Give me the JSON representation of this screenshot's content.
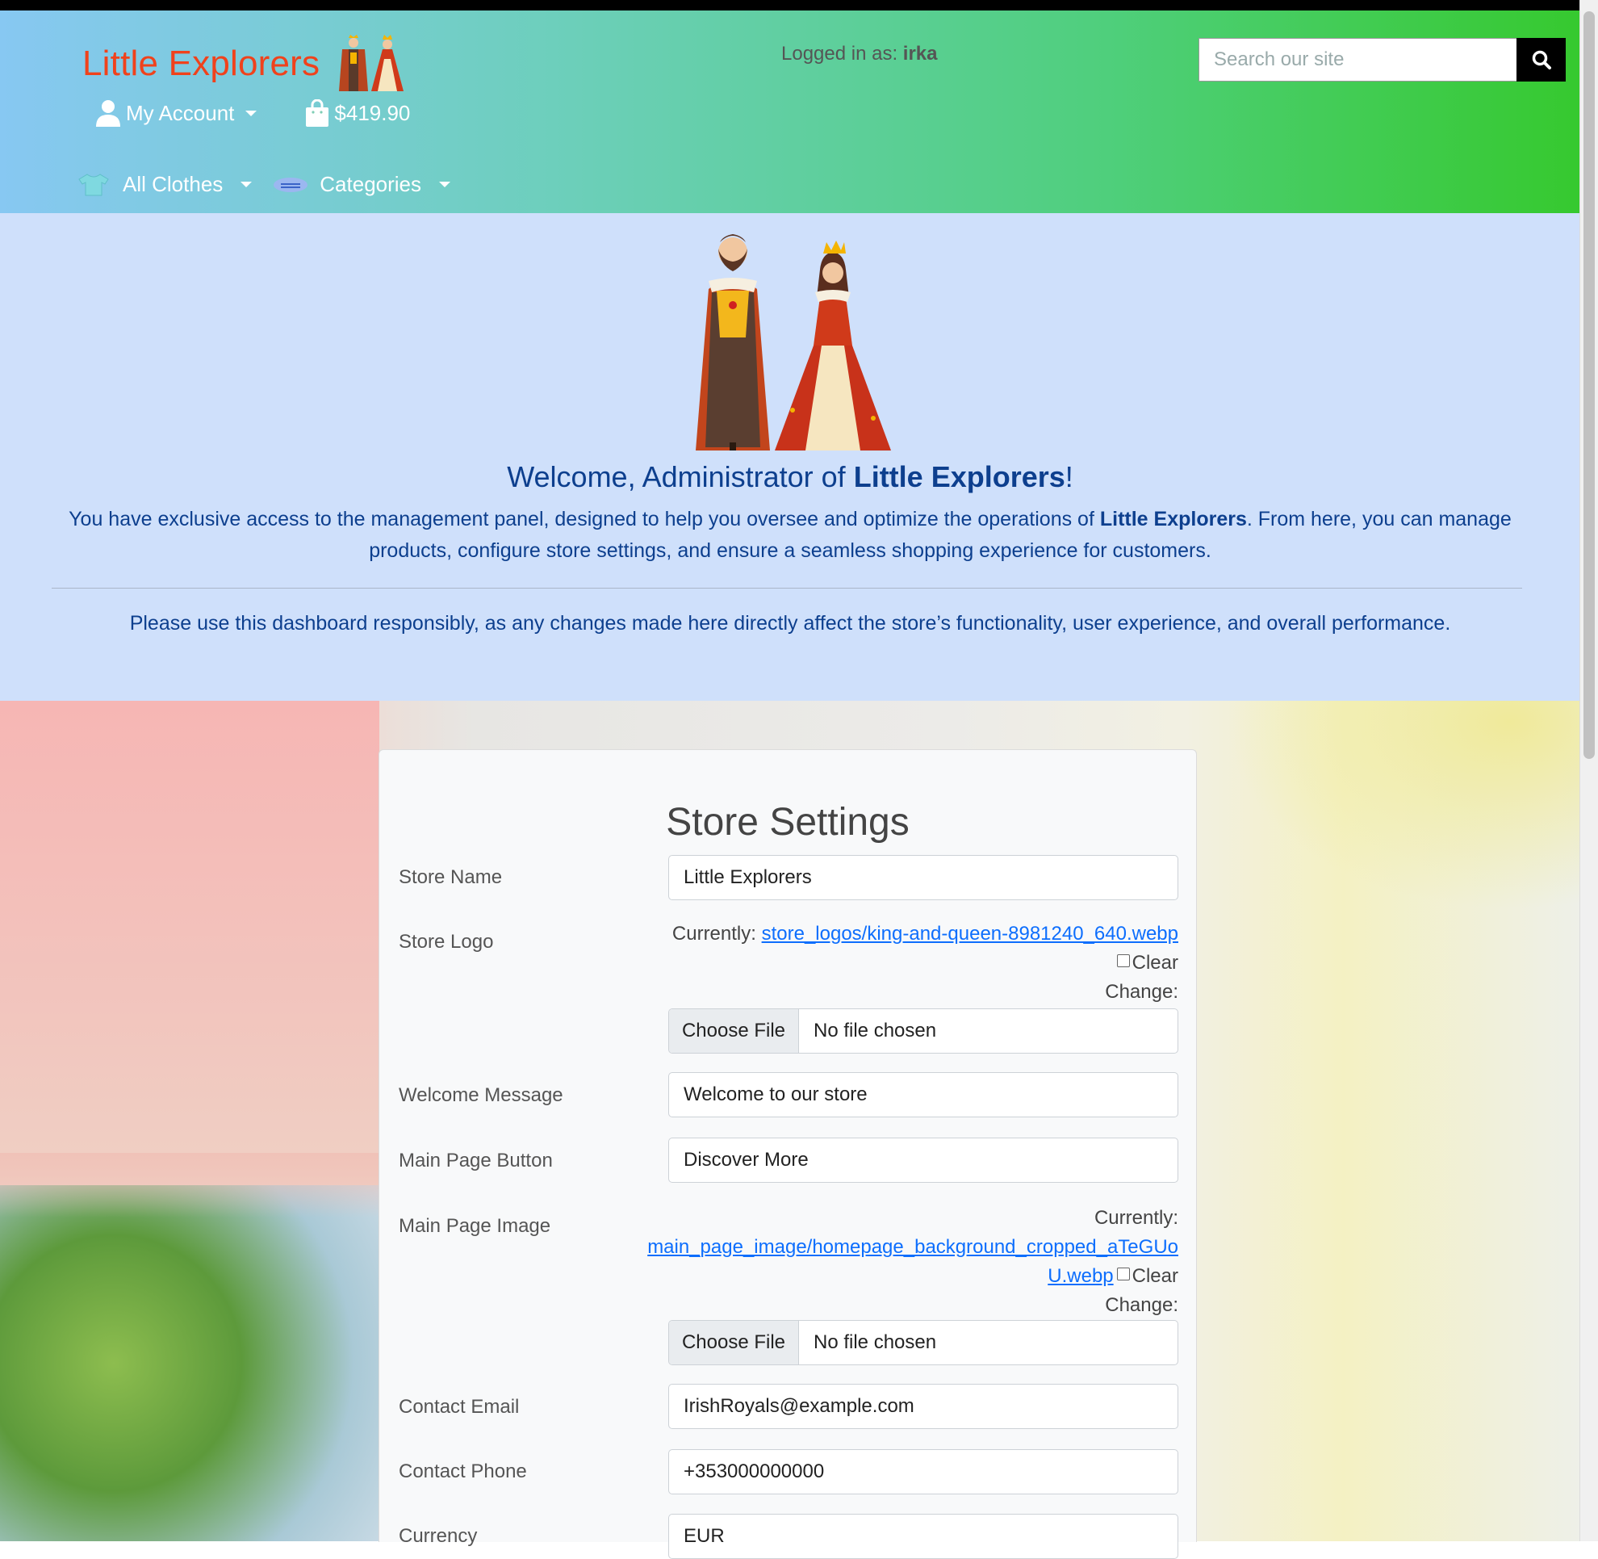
{
  "header": {
    "brand_name": "Little Explorers",
    "logged_in_prefix": "Logged in as:",
    "logged_in_user": "irka",
    "search_placeholder": "Search our site",
    "my_account_label": "My Account",
    "cart_total": "$419.90",
    "all_clothes_label": "All Clothes",
    "categories_label": "Categories",
    "colors": {
      "brand": "#f0421c",
      "gradient_start": "#87c8f2",
      "gradient_end": "#36c92f"
    }
  },
  "hero": {
    "welcome_prefix": "Welcome, Administrator of ",
    "store_name": "Little Explorers",
    "welcome_suffix": "!",
    "desc_part1": "You have exclusive access to the management panel, designed to help you oversee and optimize the operations of ",
    "desc_store": "Little Explorers",
    "desc_part2": ". From here, you can manage products, configure store settings, and ensure a seamless shopping experience for customers.",
    "warning": "Please use this dashboard responsibly, as any changes made here directly affect the store’s functionality, user experience, and overall performance."
  },
  "settings": {
    "title": "Store Settings",
    "store_name_label": "Store Name",
    "store_name_value": "Little Explorers",
    "store_logo_label": "Store Logo",
    "currently_label": "Currently:",
    "store_logo_link": "store_logos/king-and-queen-8981240_640.webp",
    "clear_label": "Clear",
    "change_label": "Change:",
    "choose_file_label": "Choose File",
    "no_file_label": "No file chosen",
    "welcome_message_label": "Welcome Message",
    "welcome_message_value": "Welcome to our store",
    "main_button_label": "Main Page Button",
    "main_button_value": "Discover More",
    "main_image_label": "Main Page Image",
    "main_image_link_line1": "main_page_image/homepage_background_cropped_aTeGUo",
    "main_image_link_line2": "U.webp",
    "contact_email_label": "Contact Email",
    "contact_email_value": "IrishRoyals@example.com",
    "contact_phone_label": "Contact Phone",
    "contact_phone_value": "+353000000000",
    "currency_label": "Currency",
    "currency_value": "EUR"
  }
}
